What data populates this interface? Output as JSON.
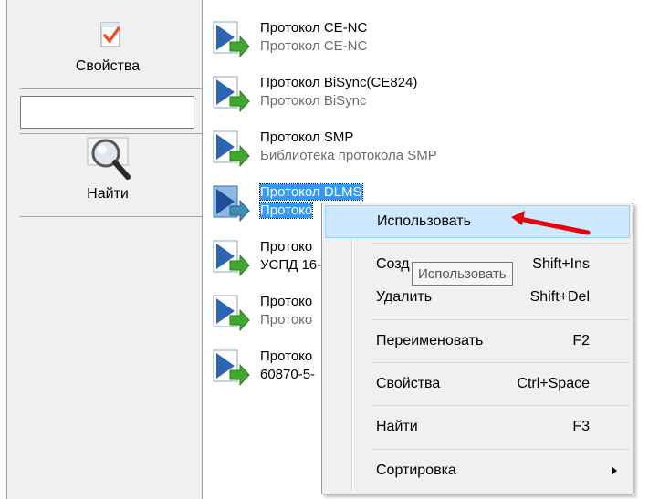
{
  "sidebar": {
    "properties_label": "Свойства",
    "search_value": "",
    "find_label": "Найти"
  },
  "protocols": [
    {
      "title": "Протокол CE-NC",
      "subtitle": "Протокол CE-NC",
      "selected": false
    },
    {
      "title": "Протокол BiSync(CE824)",
      "subtitle": "Протокол BiSync",
      "selected": false
    },
    {
      "title": "Протокол SMP",
      "subtitle": "Библиотека протокола SMP",
      "selected": false
    },
    {
      "title": "Протокол DLMS",
      "subtitle": "Протоко",
      "selected": true
    },
    {
      "title": "Протоко",
      "subtitle": "УСПД 16-",
      "selected": false
    },
    {
      "title": "Протоко",
      "subtitle": "Протоко",
      "selected": false
    },
    {
      "title": "Протоко",
      "subtitle": "60870-5-",
      "selected": false
    }
  ],
  "context_menu": {
    "use": {
      "label": "Использовать",
      "shortcut": ""
    },
    "create": {
      "label": "Созд",
      "shortcut": "Shift+Ins"
    },
    "delete": {
      "label": "Удалить",
      "shortcut": "Shift+Del"
    },
    "rename": {
      "label": "Переименовать",
      "shortcut": "F2"
    },
    "properties": {
      "label": "Свойства",
      "shortcut": "Ctrl+Space"
    },
    "find": {
      "label": "Найти",
      "shortcut": "F3"
    },
    "sort": {
      "label": "Сортировка",
      "shortcut": ""
    }
  },
  "tooltip": "Использовать",
  "colors": {
    "selection": "#3399ff",
    "menu_highlight": "#cce8ff",
    "annotation_arrow": "#e8000b"
  }
}
